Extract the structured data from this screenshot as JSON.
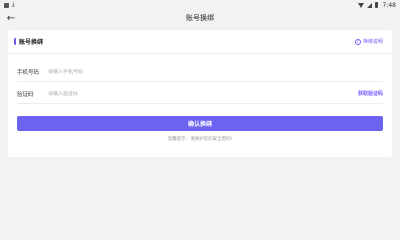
{
  "status_bar": {
    "time": "7:48"
  },
  "nav": {
    "back_icon": "←",
    "title": "账号换绑"
  },
  "card": {
    "title": "账号换绑",
    "help_label": "换绑说明",
    "help_icon": "?"
  },
  "form": {
    "phone": {
      "label": "手机号码",
      "value": "",
      "placeholder": "请输入手机号码"
    },
    "code": {
      "label": "验证码",
      "value": "",
      "placeholder": "请输入验证码",
      "get_code_label": "获取验证码"
    }
  },
  "confirm_label": "确认换绑",
  "tip": "温馨提示：请保护您的安全密码!",
  "colors": {
    "accent": "#6c63f0",
    "link": "#7b5cff",
    "background": "#f2f2f5"
  }
}
